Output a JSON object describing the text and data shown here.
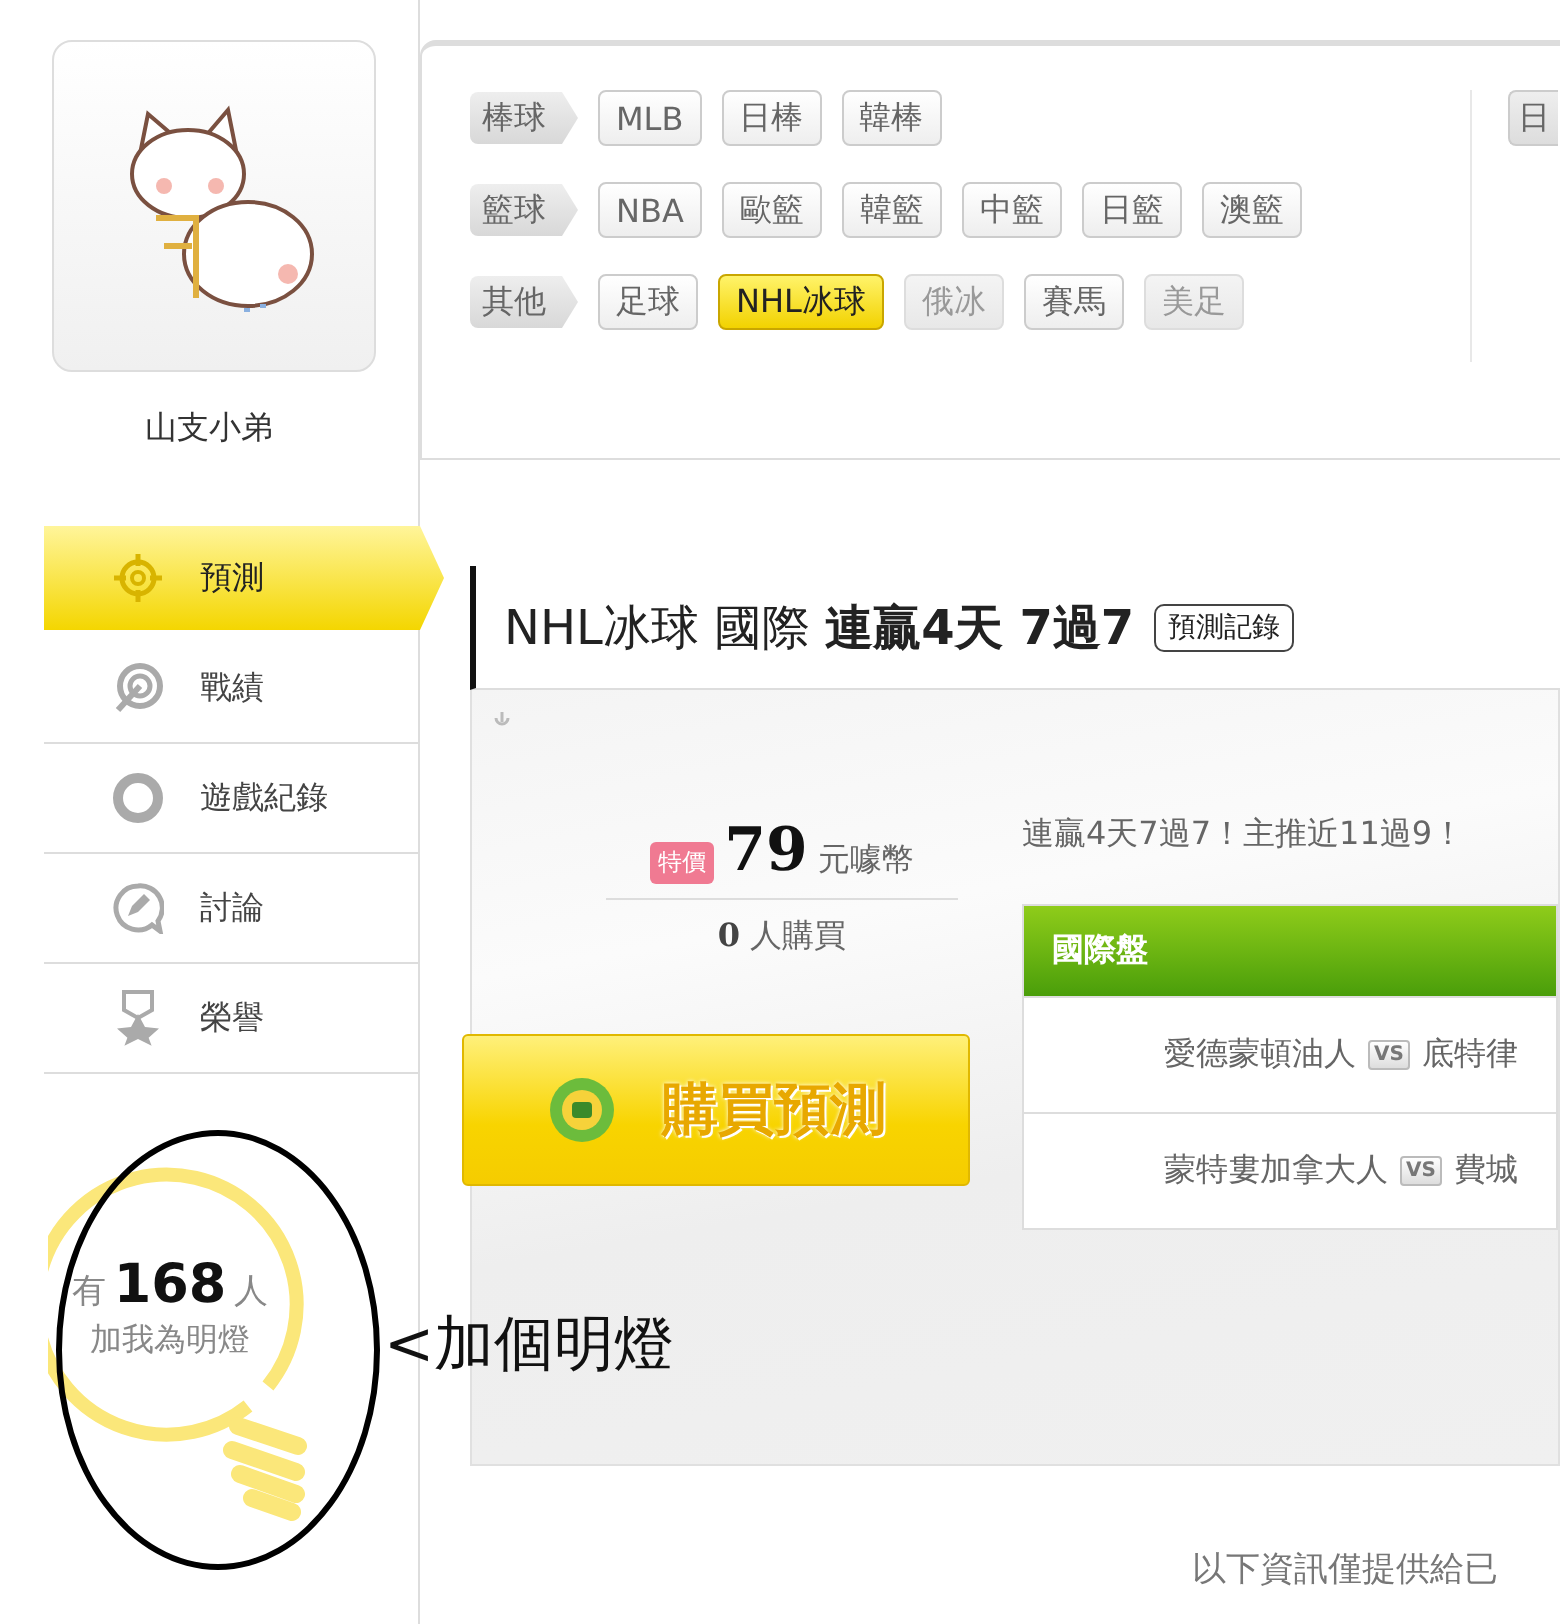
{
  "user": {
    "name": "山支小弟"
  },
  "categories": [
    {
      "label": "棒球",
      "items": [
        {
          "label": "MLB",
          "selected": false,
          "disabled": false
        },
        {
          "label": "日棒",
          "selected": false,
          "disabled": false
        },
        {
          "label": "韓棒",
          "selected": false,
          "disabled": false
        }
      ]
    },
    {
      "label": "籃球",
      "items": [
        {
          "label": "NBA",
          "selected": false,
          "disabled": false
        },
        {
          "label": "歐籃",
          "selected": false,
          "disabled": false
        },
        {
          "label": "韓籃",
          "selected": false,
          "disabled": false
        },
        {
          "label": "中籃",
          "selected": false,
          "disabled": false
        },
        {
          "label": "日籃",
          "selected": false,
          "disabled": false
        },
        {
          "label": "澳籃",
          "selected": false,
          "disabled": false
        }
      ]
    },
    {
      "label": "其他",
      "items": [
        {
          "label": "足球",
          "selected": false,
          "disabled": false
        },
        {
          "label": "NHL冰球",
          "selected": true,
          "disabled": false
        },
        {
          "label": "俄冰",
          "selected": false,
          "disabled": true
        },
        {
          "label": "賽馬",
          "selected": false,
          "disabled": false
        },
        {
          "label": "美足",
          "selected": false,
          "disabled": true
        }
      ]
    }
  ],
  "right_column_chip": "日",
  "nav": [
    {
      "label": "預測",
      "selected": true
    },
    {
      "label": "戰績",
      "selected": false
    },
    {
      "label": "遊戲紀錄",
      "selected": false
    },
    {
      "label": "討論",
      "selected": false
    },
    {
      "label": "榮譽",
      "selected": false
    }
  ],
  "fans": {
    "prefix": "有",
    "count": "168",
    "suffix": "人",
    "caption": "加我為明燈"
  },
  "annotation": "<加個明燈",
  "title": {
    "sport": "NHL冰球",
    "region": "國際",
    "streak": "連贏4天 7過7",
    "history_button": "預測記錄"
  },
  "offer": {
    "badge": "特價",
    "price": "79",
    "unit": "元噱幣",
    "buyers": "0",
    "buyers_label": "人購買",
    "buy_button": "購買預測"
  },
  "summary": "連贏4天7過7！主推近11過9！",
  "games": {
    "header": "國際盤",
    "rows": [
      {
        "home": "愛德蒙頓油人",
        "vs": "VS",
        "away": "底特律"
      },
      {
        "home": "蒙特婁加拿大人",
        "vs": "VS",
        "away": "費城"
      }
    ]
  },
  "footer": "以下資訊僅提供給已"
}
